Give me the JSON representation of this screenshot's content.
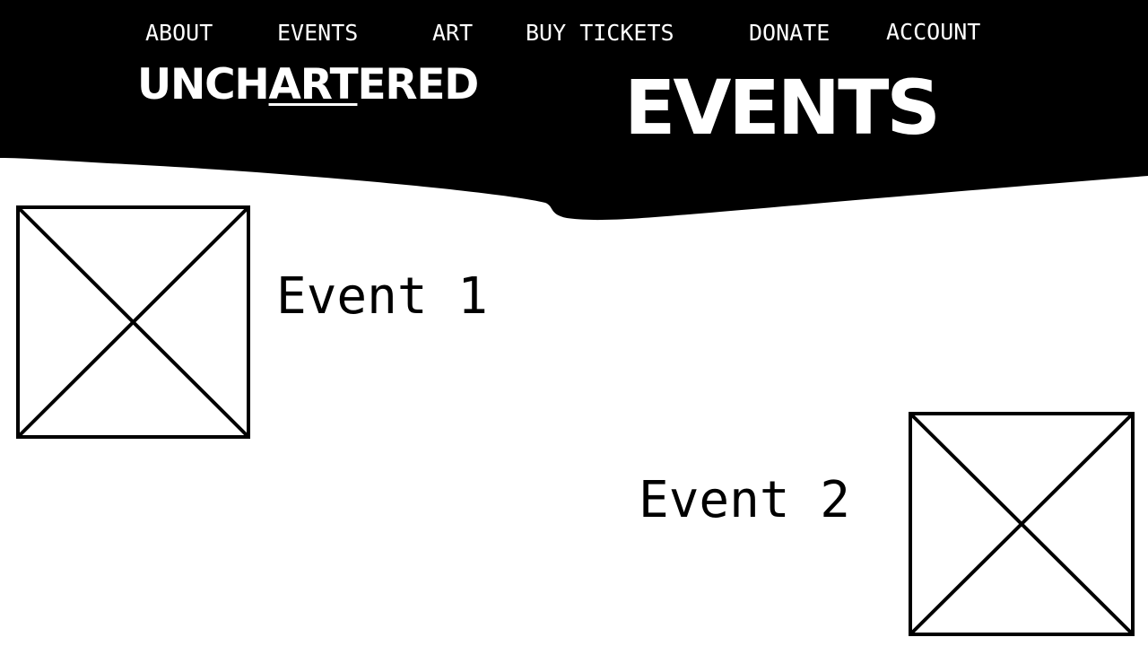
{
  "nav": {
    "items": [
      {
        "label": "ABOUT"
      },
      {
        "label": "EVENTS"
      },
      {
        "label": "ART"
      },
      {
        "label": "BUY TICKETS"
      },
      {
        "label": "DONATE"
      },
      {
        "label": "ACCOUNT"
      }
    ]
  },
  "logo": {
    "prefix": "UNCH",
    "highlight": "ART",
    "suffix": "ERED"
  },
  "page": {
    "title": "EVENTS"
  },
  "events": [
    {
      "title": "Event 1",
      "image_icon": "image-placeholder-icon"
    },
    {
      "title": "Event 2",
      "image_icon": "image-placeholder-icon"
    }
  ],
  "colors": {
    "header_background": "#000000",
    "header_text": "#ffffff",
    "page_background": "#ffffff",
    "body_text": "#000000"
  }
}
